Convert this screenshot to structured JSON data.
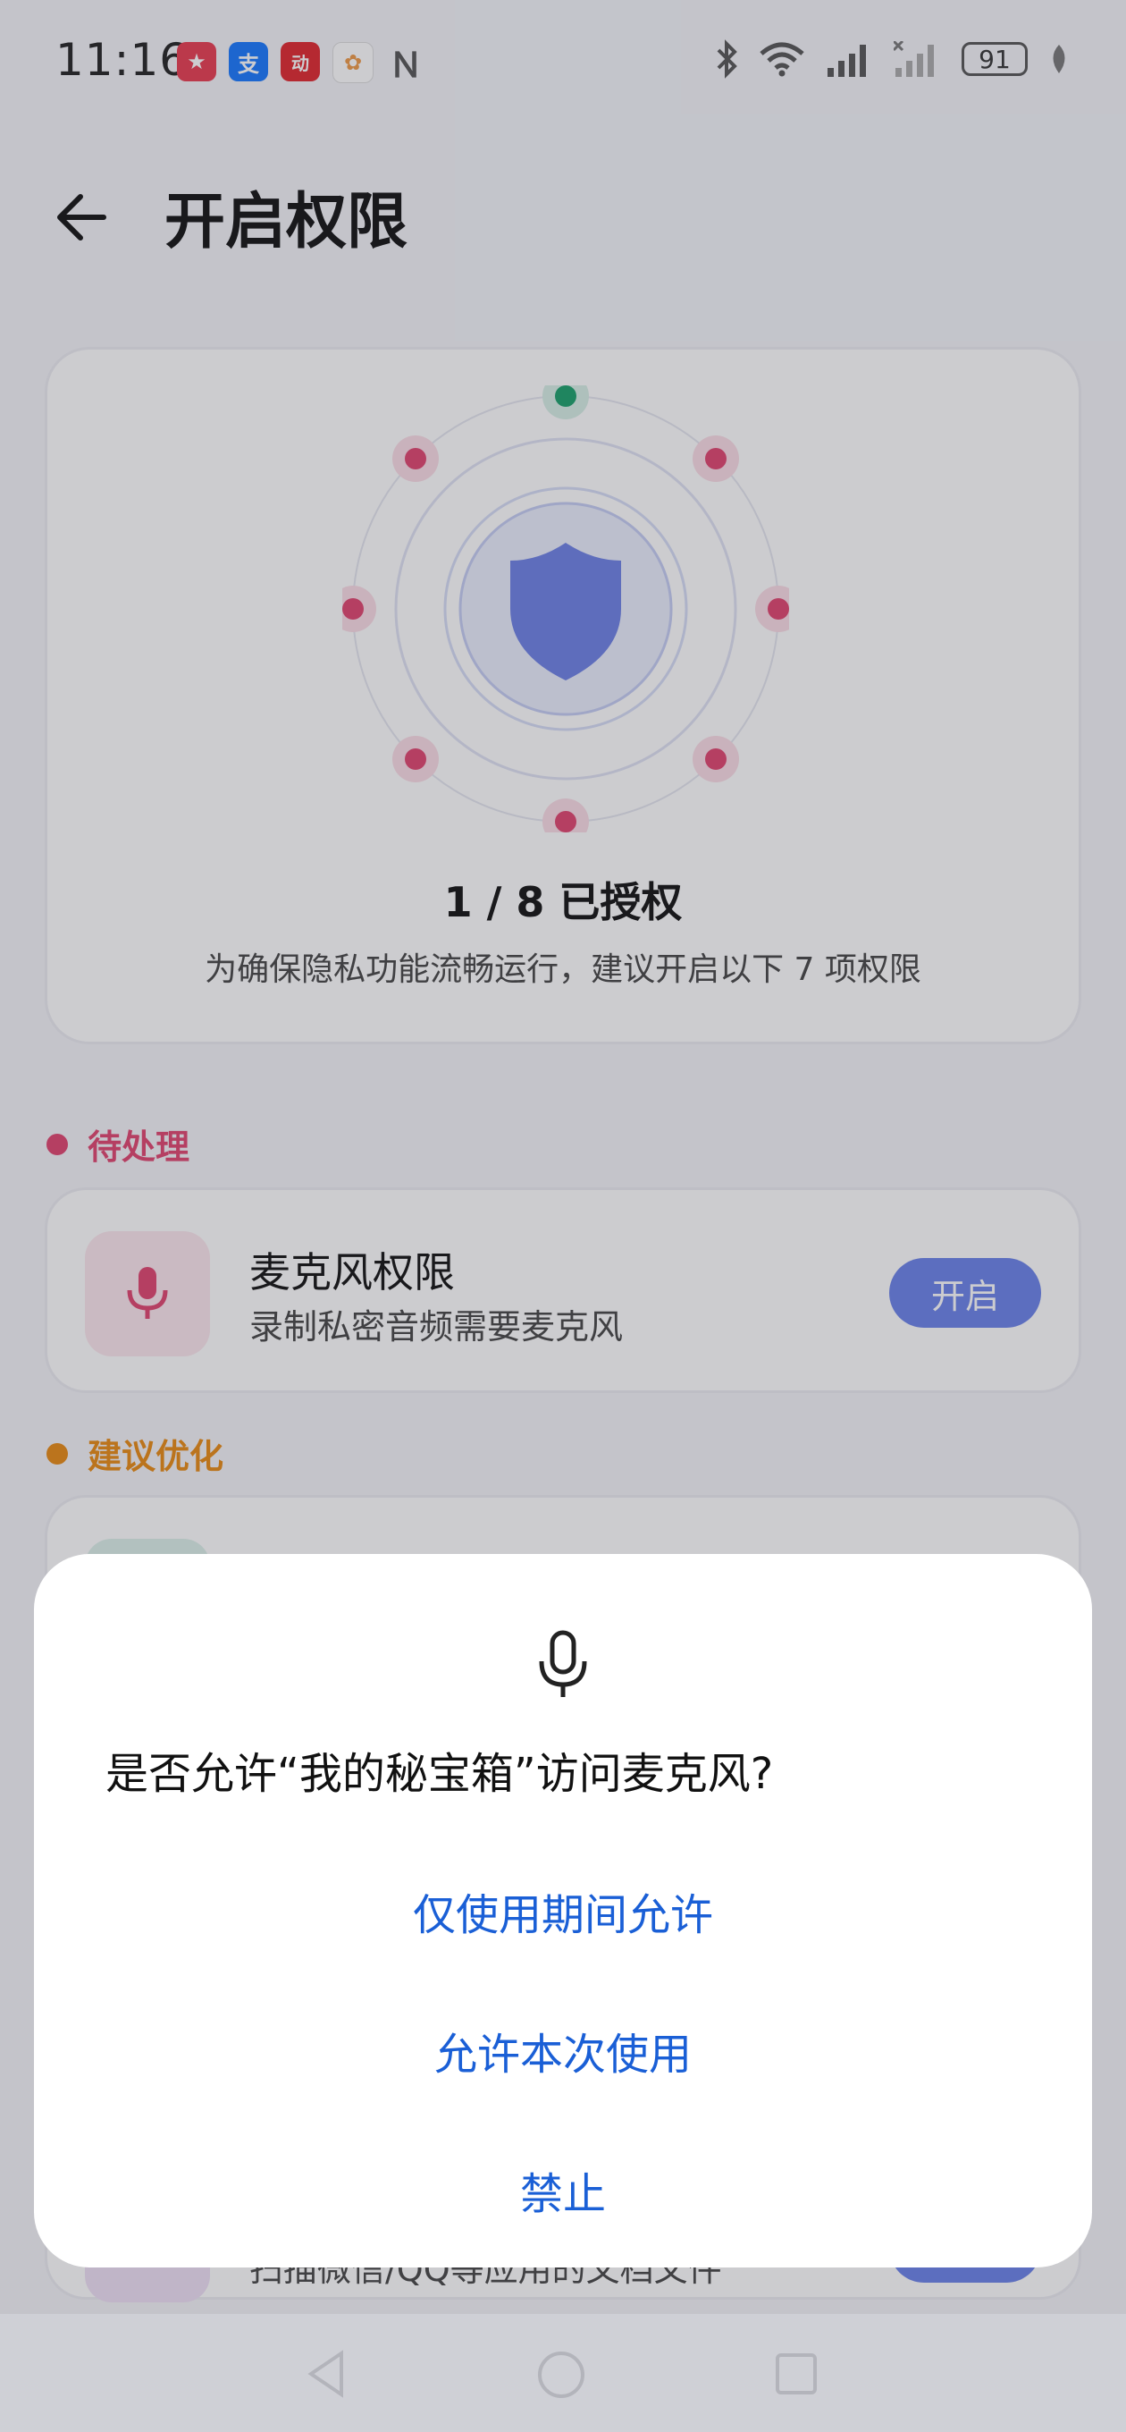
{
  "status_bar": {
    "time": "11:16",
    "battery": "91",
    "app_icons": [
      {
        "name": "app-icon-1",
        "color": "#e93b4f",
        "glyph": "★"
      },
      {
        "name": "alipay-icon",
        "color": "#1677ff",
        "glyph": "支"
      },
      {
        "name": "app-icon-3",
        "color": "#e0262d",
        "glyph": "动"
      },
      {
        "name": "app-icon-4",
        "color": "#ffffff",
        "glyph": "✿"
      }
    ]
  },
  "header": {
    "title": "开启权限"
  },
  "summary": {
    "count_text": "1 / 8  已授权",
    "description": "为确保隐私功能流畅运行，建议开启以下 7 项权限",
    "granted": 1,
    "total": 8
  },
  "sections": {
    "pending_label": "待处理",
    "suggest_label": "建议优化",
    "pending_color": "#e0436e",
    "suggest_color": "#e88a12"
  },
  "permission": {
    "title": "麦克风权限",
    "subtitle": "录制私密音频需要麦克风",
    "button": "开启"
  },
  "background_partial": {
    "subtitle": "扫描微信/QQ等应用的文档文件"
  },
  "dialog": {
    "question": "是否允许“我的秘宝箱”访问麦克风?",
    "options": [
      "仅使用期间允许",
      "允许本次使用",
      "禁止"
    ],
    "accent": "#1a5fd6"
  }
}
